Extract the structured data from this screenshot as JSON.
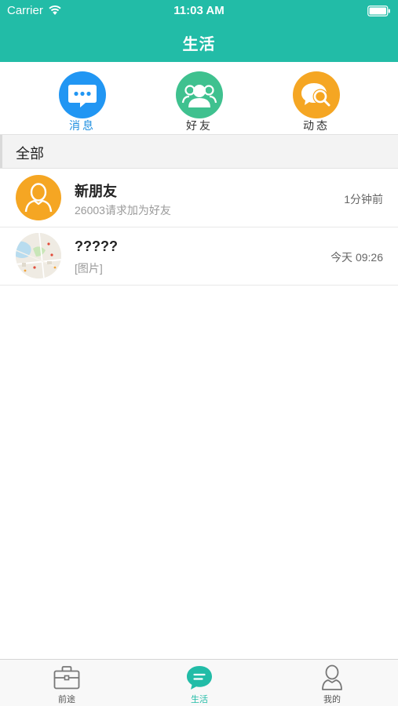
{
  "status_bar": {
    "carrier": "Carrier",
    "time": "11:03 AM"
  },
  "nav": {
    "title": "生活"
  },
  "categories": [
    {
      "label": "消息",
      "icon": "chat-bubble-icon",
      "color": "#2196f3",
      "active": true
    },
    {
      "label": "好友",
      "icon": "friends-icon",
      "color": "#3fc18f",
      "active": false
    },
    {
      "label": "动态",
      "icon": "moments-icon",
      "color": "#f5a623",
      "active": false
    }
  ],
  "section": {
    "title": "全部"
  },
  "chats": [
    {
      "name": "新朋友",
      "preview": "26003请求加为好友",
      "time": "1分钟前",
      "avatar": "user-avatar-icon",
      "avatar_color": "#f5a623"
    },
    {
      "name": "?????",
      "preview": "[图片]",
      "time": "今天 09:26",
      "avatar": "map-thumbnail"
    }
  ],
  "tabbar": {
    "tabs": [
      {
        "label": "前途",
        "icon": "briefcase-icon",
        "active": false
      },
      {
        "label": "生活",
        "icon": "chat-icon",
        "active": true
      },
      {
        "label": "我的",
        "icon": "person-icon",
        "active": false
      }
    ]
  },
  "colors": {
    "accent": "#22bca7",
    "active_category": "#1f8fe0"
  }
}
